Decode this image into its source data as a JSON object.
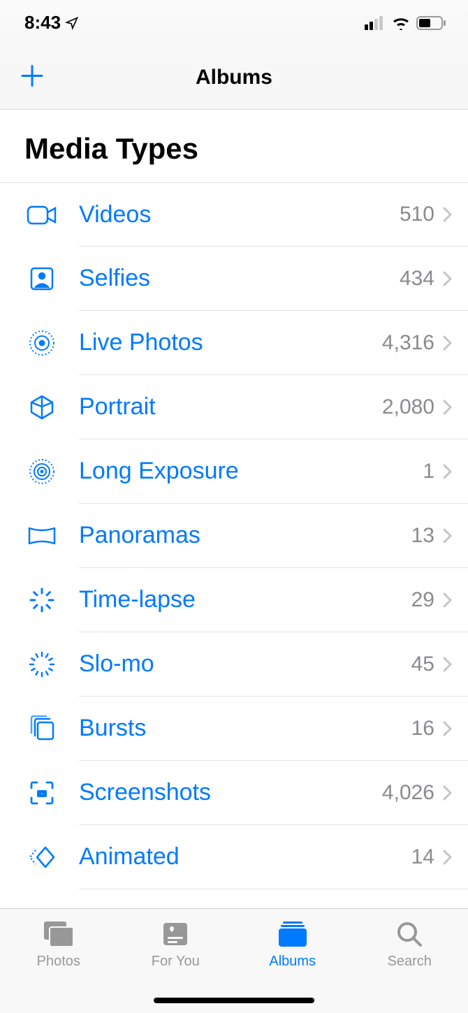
{
  "status": {
    "time": "8:43"
  },
  "header": {
    "title": "Albums"
  },
  "section": {
    "title": "Media Types"
  },
  "items": [
    {
      "label": "Videos",
      "count": "510"
    },
    {
      "label": "Selfies",
      "count": "434"
    },
    {
      "label": "Live Photos",
      "count": "4,316"
    },
    {
      "label": "Portrait",
      "count": "2,080"
    },
    {
      "label": "Long Exposure",
      "count": "1"
    },
    {
      "label": "Panoramas",
      "count": "13"
    },
    {
      "label": "Time-lapse",
      "count": "29"
    },
    {
      "label": "Slo-mo",
      "count": "45"
    },
    {
      "label": "Bursts",
      "count": "16"
    },
    {
      "label": "Screenshots",
      "count": "4,026"
    },
    {
      "label": "Animated",
      "count": "14"
    }
  ],
  "tabs": [
    {
      "label": "Photos"
    },
    {
      "label": "For You"
    },
    {
      "label": "Albums"
    },
    {
      "label": "Search"
    }
  ]
}
